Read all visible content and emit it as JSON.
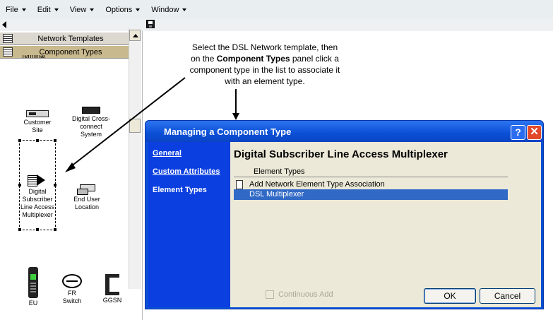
{
  "menu": {
    "file": "File",
    "edit": "Edit",
    "view": "View",
    "options": "Options",
    "window": "Window"
  },
  "left_panel": {
    "tabs": {
      "network_templates": "Network Templates",
      "component_types": "Component Types"
    },
    "cut_label": "Terminal",
    "components": {
      "customer_site": "Customer Site",
      "digital_cross_connect": "Digital Cross-connect System",
      "dslam": "Digital Subscriber Line Access Multiplexer",
      "end_user_location": "End User Location",
      "eu": "EU",
      "fr_switch": "FR Switch",
      "ggsn": "GGSN"
    }
  },
  "callout": {
    "line1": "Select the DSL Network template, then",
    "line2_pre": "on the ",
    "line2_bold": "Component Types",
    "line2_post": " panel click a",
    "line3": "component type in the list to associate it",
    "line4": "with an element type."
  },
  "dialog": {
    "title": "Managing a Component Type",
    "help": "?",
    "close": "✕",
    "nav": {
      "general": "General",
      "custom_attributes": "Custom Attributes",
      "element_types": "Element Types"
    },
    "component_title": "Digital Subscriber Line Access Multiplexer",
    "column_header": "Element Types",
    "add_row": "Add Network Element Type Association",
    "selected_row": "DSL Multiplexer",
    "continuous_add": "Continuous Add",
    "ok": "OK",
    "cancel": "Cancel"
  },
  "colors": {
    "dialog_blue": "#0a4fd6",
    "selection_blue": "#3169c6",
    "tab_active": "#c9b98e",
    "close_red": "#e2492a"
  }
}
